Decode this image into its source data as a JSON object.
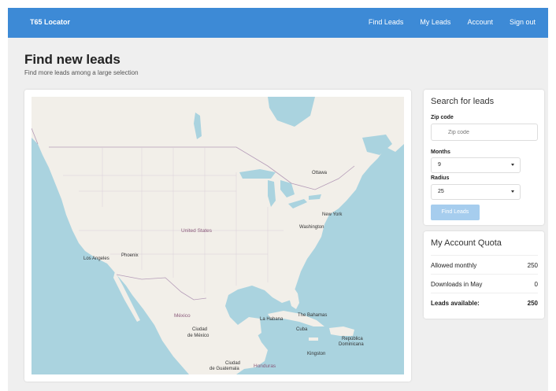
{
  "navbar": {
    "brand": "T65 Locator",
    "links": [
      "Find Leads",
      "My Leads",
      "Account",
      "Sign out"
    ],
    "color": "#3d8ad6"
  },
  "page": {
    "title": "Find new leads",
    "subtitle": "Find more leads among a large selection"
  },
  "map": {
    "labels": {
      "united_states": "United States",
      "mexico": "México",
      "ottawa": "Ottawa",
      "new_york": "New York",
      "washington": "Washington",
      "los_angeles": "Los Angeles",
      "phoenix": "Phoenix",
      "la_habana": "La Habana",
      "cuba": "Cuba",
      "bahamas": "The Bahamas",
      "republica": "República",
      "dominicana": "Dominicana",
      "kingston": "Kingston",
      "ciudad_mexico_1": "Ciudad",
      "ciudad_mexico_2": "de México",
      "ciudad_guatemala_1": "Ciudad",
      "ciudad_guatemala_2": "de Guatemala",
      "honduras": "Honduras"
    }
  },
  "search": {
    "title": "Search for leads",
    "zip_label": "Zip code",
    "zip_placeholder": "Zip code",
    "zip_value": "",
    "months_label": "Months",
    "months_value": "9",
    "radius_label": "Radius",
    "radius_value": "25",
    "button_label": "Find Leads",
    "button_color": "#a6cdee"
  },
  "quota": {
    "title": "My Account Quota",
    "rows": [
      {
        "label": "Allowed monthly",
        "value": "250"
      },
      {
        "label": "Downloads in May",
        "value": "0"
      },
      {
        "label": "Leads available:",
        "value": "250"
      }
    ]
  }
}
